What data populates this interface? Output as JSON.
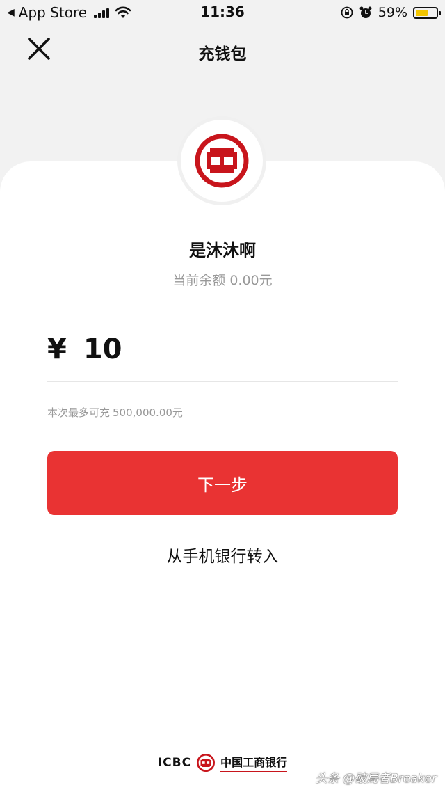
{
  "status_bar": {
    "back_app": "App Store",
    "time": "11:36",
    "battery_percent": "59%",
    "battery_level": 0.59
  },
  "nav": {
    "title": "充钱包",
    "close_icon": "close-icon"
  },
  "account": {
    "bank_logo": "icbc-logo-icon",
    "name": "是沐沐啊",
    "balance_label": "当前余额",
    "balance_value": "0.00元"
  },
  "recharge": {
    "currency_symbol": "¥",
    "amount": "10",
    "limit_label": "本次最多可充",
    "limit_value": "500,000.00元"
  },
  "actions": {
    "next_label": "下一步",
    "transfer_label": "从手机银行转入"
  },
  "footer": {
    "brand_en": "ICBC",
    "brand_cn": "中国工商银行"
  },
  "watermark": "头条 @破局者Breaker",
  "colors": {
    "accent": "#e93333",
    "logo_red": "#c8151c",
    "background": "#f2f2f2"
  }
}
